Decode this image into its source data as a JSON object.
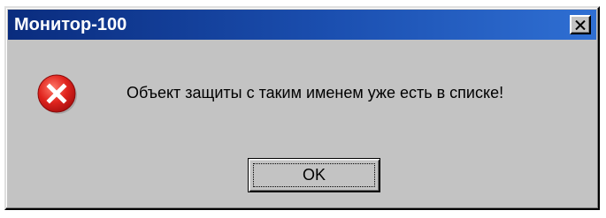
{
  "window": {
    "title": "Монитор-100"
  },
  "titlebar": {
    "close_icon": "close-icon"
  },
  "body": {
    "icon": "error-icon",
    "message": "Объект защиты с таким именем уже есть в списке!"
  },
  "buttons": {
    "ok_label": "OK"
  },
  "colors": {
    "titlebar_start": "#0a2c7e",
    "titlebar_end": "#2f6fd3",
    "dialog_bg": "#c3c3c3",
    "error_red": "#d8191b"
  }
}
